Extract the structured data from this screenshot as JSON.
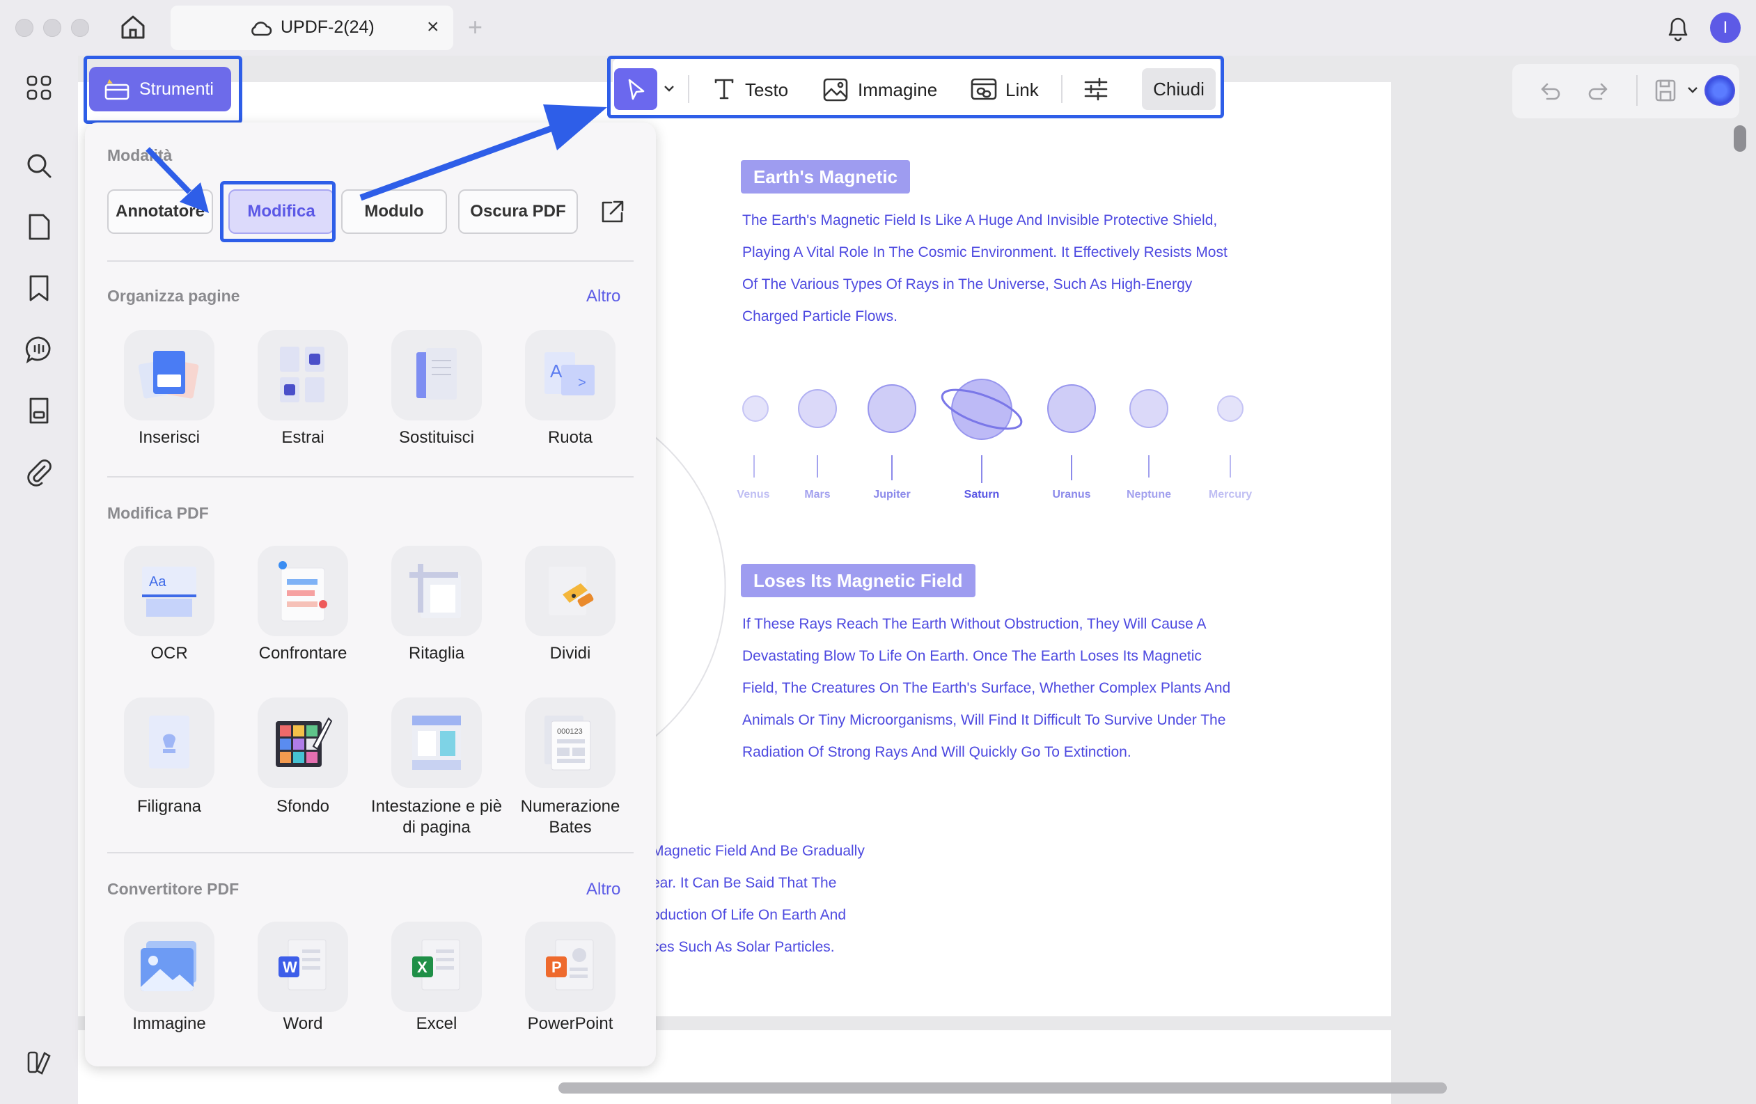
{
  "tab": {
    "title": "UPDF-2(24)"
  },
  "user": {
    "initial": "I"
  },
  "tools_button": {
    "label": "Strumenti"
  },
  "toolbar": {
    "text": "Testo",
    "image": "Immagine",
    "link": "Link",
    "close": "Chiudi"
  },
  "panel": {
    "modes_title": "Modalità",
    "modes": [
      "Annotatore",
      "Modifica",
      "Modulo",
      "Oscura PDF"
    ],
    "organize": {
      "title": "Organizza pagine",
      "more": "Altro",
      "items": [
        "Inserisci",
        "Estrai",
        "Sostituisci",
        "Ruota"
      ]
    },
    "edit": {
      "title": "Modifica PDF",
      "items": [
        "OCR",
        "Confrontare",
        "Ritaglia",
        "Dividi",
        "Filigrana",
        "Sfondo",
        "Intestazione e piè di pagina",
        "Numerazione Bates"
      ]
    },
    "convert": {
      "title": "Convertitore PDF",
      "more": "Altro",
      "items": [
        "Immagine",
        "Word",
        "Excel",
        "PowerPoint"
      ]
    }
  },
  "doc": {
    "heading1": "Earth's Magnetic",
    "para1": [
      "The Earth's Magnetic Field Is Like A Huge And Invisible Protective Shield,",
      "Playing A Vital Role In The Cosmic Environment. It Effectively Resists Most",
      "Of The Various Types Of Rays in The Universe, Such As High-Energy",
      "Charged Particle Flows."
    ],
    "planets": [
      "Venus",
      "Mars",
      "Jupiter",
      "Saturn",
      "Uranus",
      "Neptune",
      "Mercury"
    ],
    "heading2": "Loses Its Magnetic Field",
    "para2": [
      "If These Rays Reach The Earth Without Obstruction, They Will Cause A",
      "Devastating Blow To Life On Earth. Once The Earth Loses Its Magnetic",
      "Field, The Creatures On The Earth's Surface, Whether Complex Plants And",
      "Animals Or Tiny Microorganisms, Will Find It Difficult To Survive Under The",
      "Radiation Of Strong Rays And Will Quickly Go To Extinction."
    ],
    "para3": [
      "Magnetic Field And Be Gradually",
      "ear. It Can Be Said That The",
      "oduction Of Life On Earth And",
      "ces Such As Solar Particles."
    ]
  },
  "colors": {
    "accent": "#6d6bea",
    "highlight": "#2e5ee8",
    "doc_text": "#4d49e0"
  }
}
